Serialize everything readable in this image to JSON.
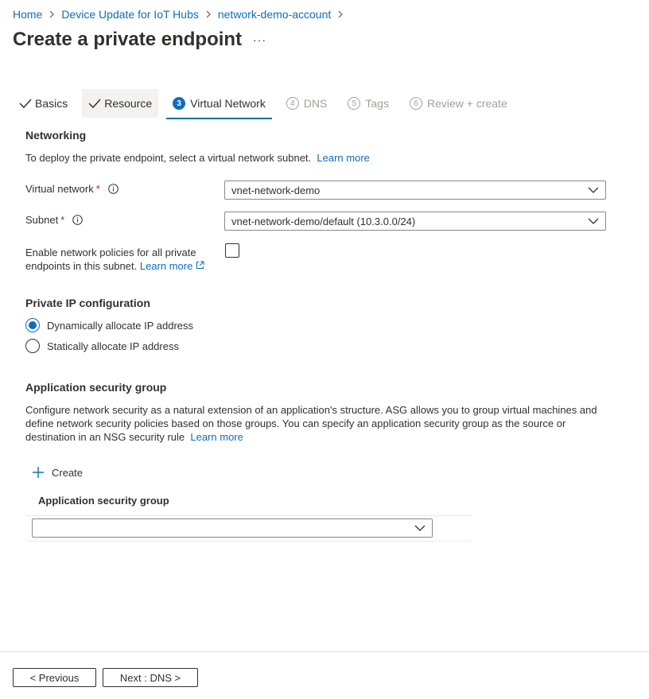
{
  "breadcrumb": {
    "items": [
      "Home",
      "Device Update for IoT Hubs",
      "network-demo-account"
    ]
  },
  "page": {
    "title": "Create a private endpoint",
    "more_label": "···"
  },
  "tabs": [
    {
      "label": "Basics",
      "state": "completed"
    },
    {
      "label": "Resource",
      "state": "completed"
    },
    {
      "label": "Virtual Network",
      "step": "3",
      "state": "active"
    },
    {
      "label": "DNS",
      "step": "4",
      "state": "disabled"
    },
    {
      "label": "Tags",
      "step": "5",
      "state": "disabled"
    },
    {
      "label": "Review + create",
      "step": "6",
      "state": "disabled"
    }
  ],
  "networking": {
    "title": "Networking",
    "description": "To deploy the private endpoint, select a virtual network subnet.",
    "learn_more": "Learn more",
    "virtual_network": {
      "label": "Virtual network",
      "required": "*",
      "value": "vnet-network-demo"
    },
    "subnet": {
      "label": "Subnet",
      "required": "*",
      "value": "vnet-network-demo/default (10.3.0.0/24)"
    },
    "policies": {
      "line1": "Enable network policies for all private",
      "line2": "endpoints in this subnet.",
      "learn_more": "Learn more",
      "checked": false
    }
  },
  "ip_config": {
    "title": "Private IP configuration",
    "options": [
      {
        "label": "Dynamically allocate IP address",
        "selected": true
      },
      {
        "label": "Statically allocate IP address",
        "selected": false
      }
    ]
  },
  "asg": {
    "title": "Application security group",
    "line1": "Configure network security as a natural extension of an application's structure. ASG allows you to group virtual machines and",
    "line2": "define network security policies based on those groups. You can specify an application security group as the source or",
    "line3": "destination in an NSG security rule",
    "learn_more": "Learn more",
    "create_label": "Create",
    "column_header": "Application security group",
    "select_value": ""
  },
  "footer": {
    "previous_label": "< Previous",
    "next_label": "Next : DNS >"
  },
  "colors": {
    "accent": "#0f6cbd",
    "required": "#a4262c",
    "disabled_text": "#a19f9d"
  }
}
